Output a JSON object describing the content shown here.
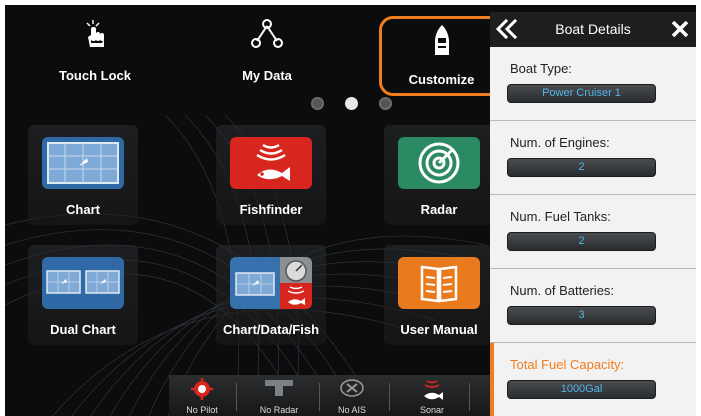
{
  "top_bar": {
    "touch_lock": {
      "label": "Touch Lock",
      "icon": "touch-lock-icon"
    },
    "my_data": {
      "label": "My Data",
      "icon": "my-data-icon"
    },
    "customize": {
      "label": "Customize",
      "icon": "boat-icon",
      "selected": true
    }
  },
  "page_indicator": {
    "pages": 3,
    "current": 2
  },
  "apps": [
    {
      "label": "Chart",
      "icon": "chart-icon"
    },
    {
      "label": "Fishfinder",
      "icon": "fishfinder-icon"
    },
    {
      "label": "Radar",
      "icon": "radar-icon"
    },
    {
      "label": "Dual Chart",
      "icon": "dual-chart-icon"
    },
    {
      "label": "Chart/Data/Fish",
      "icon": "chart-data-fish-icon"
    },
    {
      "label": "User Manual",
      "icon": "user-manual-icon"
    }
  ],
  "status_bar": [
    {
      "label": "No Pilot",
      "icon": "pilot-icon"
    },
    {
      "label": "No Radar",
      "icon": "radar-scanner-icon"
    },
    {
      "label": "No AIS",
      "icon": "ais-icon"
    },
    {
      "label": "Sonar",
      "icon": "sonar-icon"
    }
  ],
  "panel": {
    "title": "Boat Details",
    "fields": [
      {
        "label": "Boat Type:",
        "value": "Power Cruiser 1"
      },
      {
        "label": "Num. of Engines:",
        "value": "2"
      },
      {
        "label": "Num. Fuel Tanks:",
        "value": "2"
      },
      {
        "label": "Num. of Batteries:",
        "value": "3"
      },
      {
        "label": "Total Fuel Capacity:",
        "value": "1000Gal",
        "active": true
      }
    ]
  },
  "colors": {
    "accent": "#f07d1f",
    "value_text": "#4fb6e8",
    "panel_bg": "#f2f2f2"
  }
}
